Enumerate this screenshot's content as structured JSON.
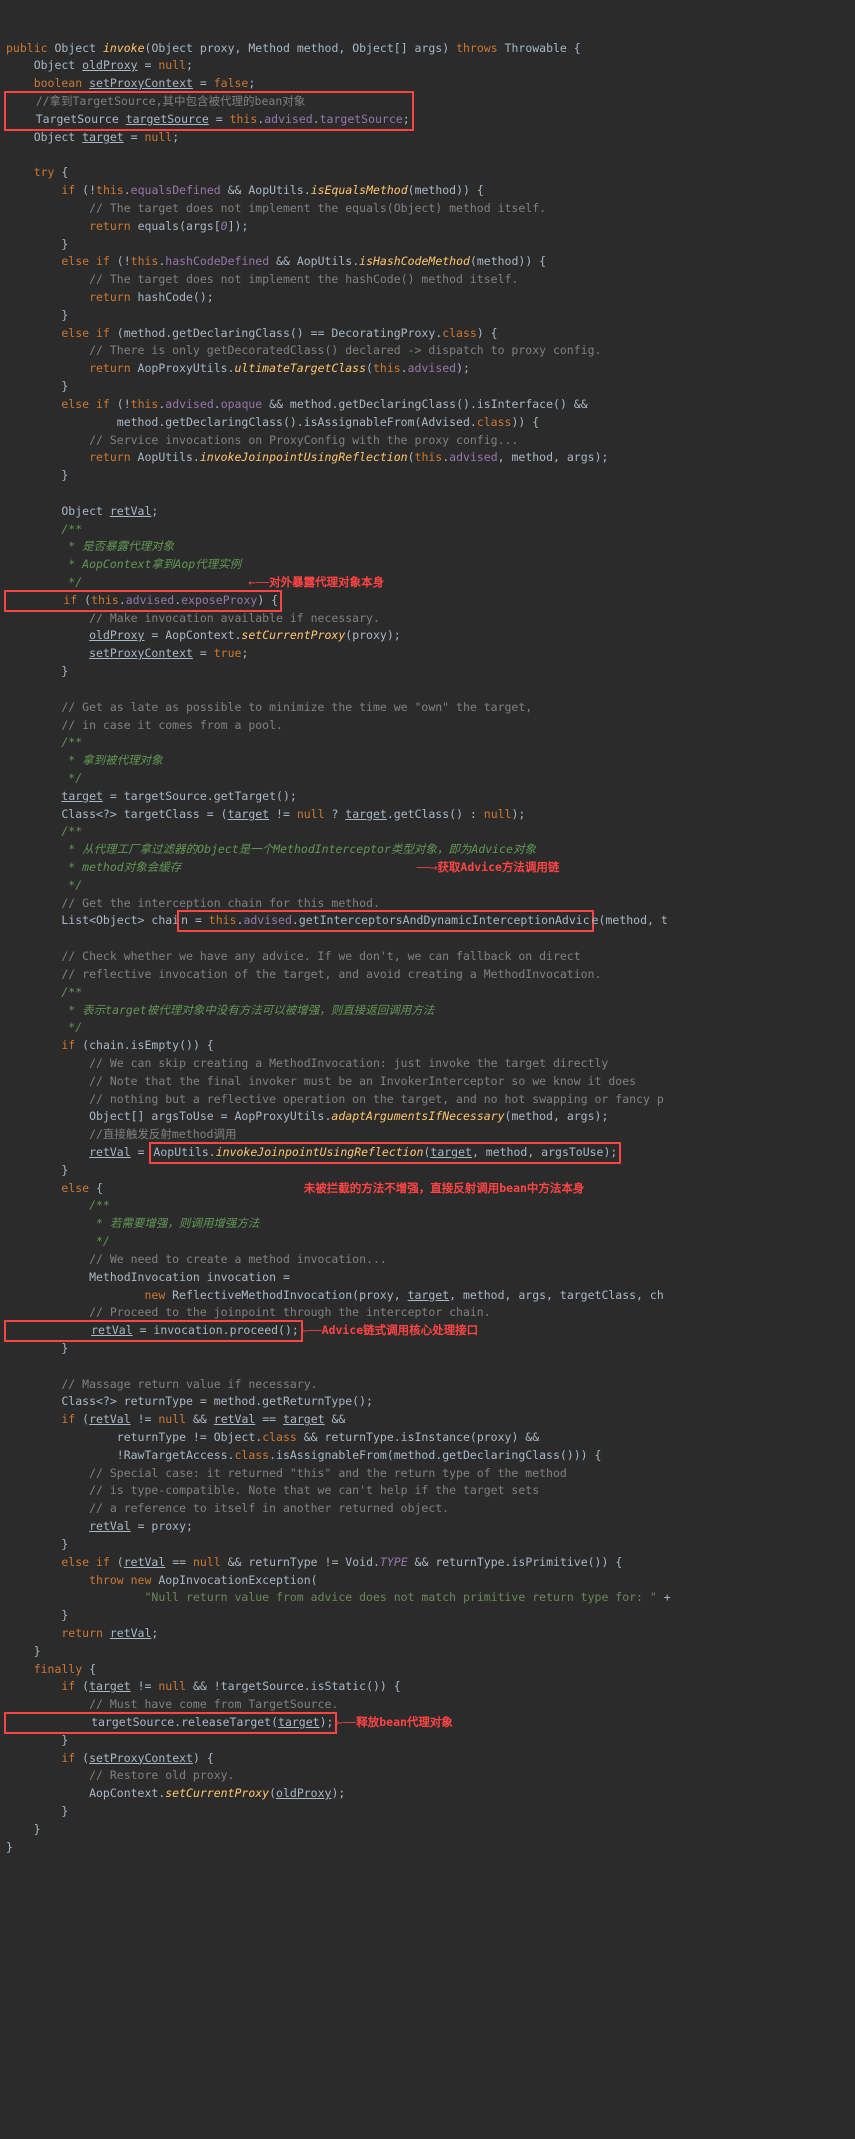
{
  "sig": {
    "pub": "public",
    "obj": "Object",
    "inv": "invoke",
    "p1": "(Object proxy, Method method, Object[] args) ",
    "thr": "throws",
    "exc": " Throwable {"
  },
  "l1": {
    "a": "    Object ",
    "b": "oldProxy",
    "c": " = ",
    "d": "null",
    "e": ";"
  },
  "l2": {
    "a": "    boolean ",
    "b": "setProxyContext",
    "c": " = ",
    "d": "false",
    "e": ";"
  },
  "l3": "    //拿到TargetSource,其中包含被代理的bean对象",
  "l4": {
    "a": "    TargetSource ",
    "b": "targetSource",
    "c": " = ",
    "d": "this",
    "e": ".",
    "f": "advised",
    "g": ".",
    "h": "targetSource",
    "i": ";"
  },
  "l5": {
    "a": "    Object ",
    "b": "target",
    "c": " = ",
    "d": "null",
    "e": ";"
  },
  "try": "    try",
  "if1": {
    "a": "        if",
    "b": " (!",
    "c": "this",
    "d": ".",
    "e": "equalsDefined",
    "f": " && AopUtils.",
    "g": "isEqualsMethod",
    "h": "(method)) {"
  },
  "c1": "            // The target does not implement the equals(Object) method itself.",
  "r1": {
    "a": "            return ",
    "b": "equals(args[",
    "c": "0",
    "d": "]);"
  },
  "cb1": "        }",
  "elif1": {
    "a": "        else if",
    "b": " (!",
    "c": "this",
    "d": ".",
    "e": "hashCodeDefined",
    "f": " && AopUtils.",
    "g": "isHashCodeMethod",
    "h": "(method)) {"
  },
  "c2": "            // The target does not implement the hashCode() method itself.",
  "r2": {
    "a": "            return",
    "b": " hashCode();"
  },
  "elif2": {
    "a": "        else if",
    "b": " (method.getDeclaringClass() == DecoratingProxy.",
    "c": "class",
    "d": ") {"
  },
  "c3": "            // There is only getDecoratedClass() declared -> dispatch to proxy config.",
  "r3": {
    "a": "            return",
    "b": " AopProxyUtils.",
    "c": "ultimateTargetClass",
    "d": "(",
    "e": "this",
    "f": ".",
    "g": "advised",
    "h": ");"
  },
  "elif3": {
    "a": "        else if",
    "b": " (!",
    "c": "this",
    "d": ".",
    "e": "advised",
    "f": ".",
    "g": "opaque",
    "h": " && method.getDeclaringClass().isInterface() &&"
  },
  "elif3b": {
    "a": "                method.getDeclaringClass().isAssignableFrom(Advised.",
    "b": "class",
    "c": ")) {"
  },
  "c4": "            // Service invocations on ProxyConfig with the proxy config...",
  "r4": {
    "a": "            return",
    "b": " AopUtils.",
    "c": "invokeJoinpointUsingReflection",
    "d": "(",
    "e": "this",
    "f": ".",
    "g": "advised",
    "h": ", method, args);"
  },
  "rv": {
    "a": "        Object ",
    "b": "retVal",
    "c": ";"
  },
  "dc1": {
    "a": "        /**",
    "b": "         * 是否暴露代理对象",
    "c": "         * AopContext拿到Aop代理实例",
    "d": "         */"
  },
  "ann1": "对外暴露代理对象本身",
  "if2": {
    "a": "        if",
    "b": " (",
    "c": "this",
    "d": ".",
    "e": "advised",
    "f": ".",
    "g": "exposeProxy",
    "h": ") {"
  },
  "c5": "            // Make invocation available if necessary.",
  "a1": {
    "a": "            ",
    "b": "oldProxy",
    "c": " = AopContext.",
    "d": "setCurrentProxy",
    "e": "(proxy);"
  },
  "a2": {
    "a": "            ",
    "b": "setProxyContext",
    "c": " = ",
    "d": "true",
    "e": ";"
  },
  "c6": "        // Get as late as possible to minimize the time we \"own\" the target,",
  "c7": "        // in case it comes from a pool.",
  "dc2": {
    "a": "        /**",
    "b": "         * 拿到被代理对象",
    "c": "         */"
  },
  "a3": {
    "a": "        ",
    "b": "target",
    "c": " = targetSource.getTarget();"
  },
  "a4": {
    "a": "        Class<?> targetClass = (",
    "b": "target",
    "c": " != ",
    "d": "null",
    "e": " ? ",
    "f": "target",
    "g": ".getClass() : ",
    "h": "null",
    "i": ");"
  },
  "dc3": {
    "a": "        /**",
    "b": "         * 从代理工厂拿过滤器的Object是一个MethodInterceptor类型对象，即为Advice对象",
    "c": "         * method对象会缓存",
    "d": "         */"
  },
  "ann2": "获取Advice方法调用链",
  "c8": "        // Get the interception chain for this method.",
  "a5": {
    "a": "        List<Object> chai",
    "b": "n = ",
    "c": "this",
    "d": ".",
    "e": "advised",
    "f": ".getInterceptorsAndDynamicInterceptionAdvic",
    "g": "e(method, t"
  },
  "c9": "        // Check whether we have any advice. If we don't, we can fallback on direct",
  "c10": "        // reflective invocation of the target, and avoid creating a MethodInvocation.",
  "dc4": {
    "a": "        /**",
    "b": "         * 表示target被代理对象中没有方法可以被增强，则直接返回调用方法",
    "c": "         */"
  },
  "if3": {
    "a": "        if",
    "b": " (chain.isEmpty()) {"
  },
  "c11": "            // We can skip creating a MethodInvocation: just invoke the target directly",
  "c12": "            // Note that the final invoker must be an InvokerInterceptor so we know it does",
  "c13": "            // nothing but a reflective operation on the target, and no hot swapping or fancy p",
  "a6": {
    "a": "            Object[] argsToUse = AopProxyUtils.",
    "b": "adaptArgumentsIfNecessary",
    "c": "(method, args);"
  },
  "c14": "            //直接触发反射method调用",
  "a7": {
    "a": "            ",
    "b": "retVal",
    "c": " = ",
    "d": "AopUtils.",
    "e": "invokeJoinpointUsingReflection",
    "f": "(",
    "g": "target",
    "h": ", method, argsToUse);"
  },
  "else1": "        else",
  "ann3": "未被拦截的方法不增强，直接反射调用bean中方法本身",
  "dc5": {
    "a": "            /**",
    "b": "             * 若需要增强，则调用增强方法",
    "c": "             */"
  },
  "c15": "            // We need to create a method invocation...",
  "a8": "            MethodInvocation invocation =",
  "a9": {
    "a": "                    new",
    "b": " ReflectiveMethodInvocation(proxy, ",
    "c": "target",
    "d": ", method, args, targetClass, ch"
  },
  "c16": "            // Proceed to the joinpoint through the interceptor chain.",
  "a10": {
    "a": "            ",
    "b": "retVal",
    "c": " = invocation.proceed();"
  },
  "ann4": "Advice链式调用核心处理接口",
  "c17": "        // Massage return value if necessary.",
  "a11": "        Class<?> returnType = method.getReturnType();",
  "if4": {
    "a": "        if",
    "b": " (",
    "c": "retVal",
    "d": " != ",
    "e": "null",
    "f": " && ",
    "g": "retVal",
    "h": " == ",
    "i": "target",
    "j": " &&"
  },
  "if4b": {
    "a": "                returnType != Object.",
    "b": "class",
    "c": " && returnType.isInstance(proxy) &&"
  },
  "if4c": {
    "a": "                !RawTargetAccess.",
    "b": "class",
    "c": ".isAssignableFrom(method.getDeclaringClass())) {"
  },
  "c18": "            // Special case: it returned \"this\" and the return type of the method",
  "c19": "            // is type-compatible. Note that we can't help if the target sets",
  "c20": "            // a reference to itself in another returned object.",
  "a12": {
    "a": "            ",
    "b": "retVal",
    "c": " = proxy;"
  },
  "elif4": {
    "a": "        else if",
    "b": " (",
    "c": "retVal",
    "d": " == ",
    "e": "null",
    "f": " && returnType != Void.",
    "g": "TYPE",
    "h": " && returnType.isPrimitive()) {"
  },
  "thr2": {
    "a": "            throw new",
    "b": " AopInvocationException("
  },
  "str1": {
    "a": "                    ",
    "b": "\"Null return value from advice does not match primitive return type for: \"",
    "c": " +"
  },
  "r5": {
    "a": "        return ",
    "b": "retVal",
    "c": ";"
  },
  "fin": "    finally",
  "if5": {
    "a": "        if",
    "b": " (",
    "c": "target",
    "d": " != ",
    "e": "null",
    "f": " && !targetSource.isStatic()) {"
  },
  "c21": "            // Must have come from TargetSource.",
  "a13": {
    "a": "            targetSource.releaseTarget(",
    "b": "target",
    "c": ");"
  },
  "ann5": "释放bean代理对象",
  "if6": {
    "a": "        if",
    "b": " (",
    "c": "setProxyContext",
    "d": ") {"
  },
  "c22": "            // Restore old proxy.",
  "a14": {
    "a": "            AopContext.",
    "b": "setCurrentProxy",
    "c": "(",
    "d": "oldProxy",
    "e": ");"
  },
  "end": "}"
}
